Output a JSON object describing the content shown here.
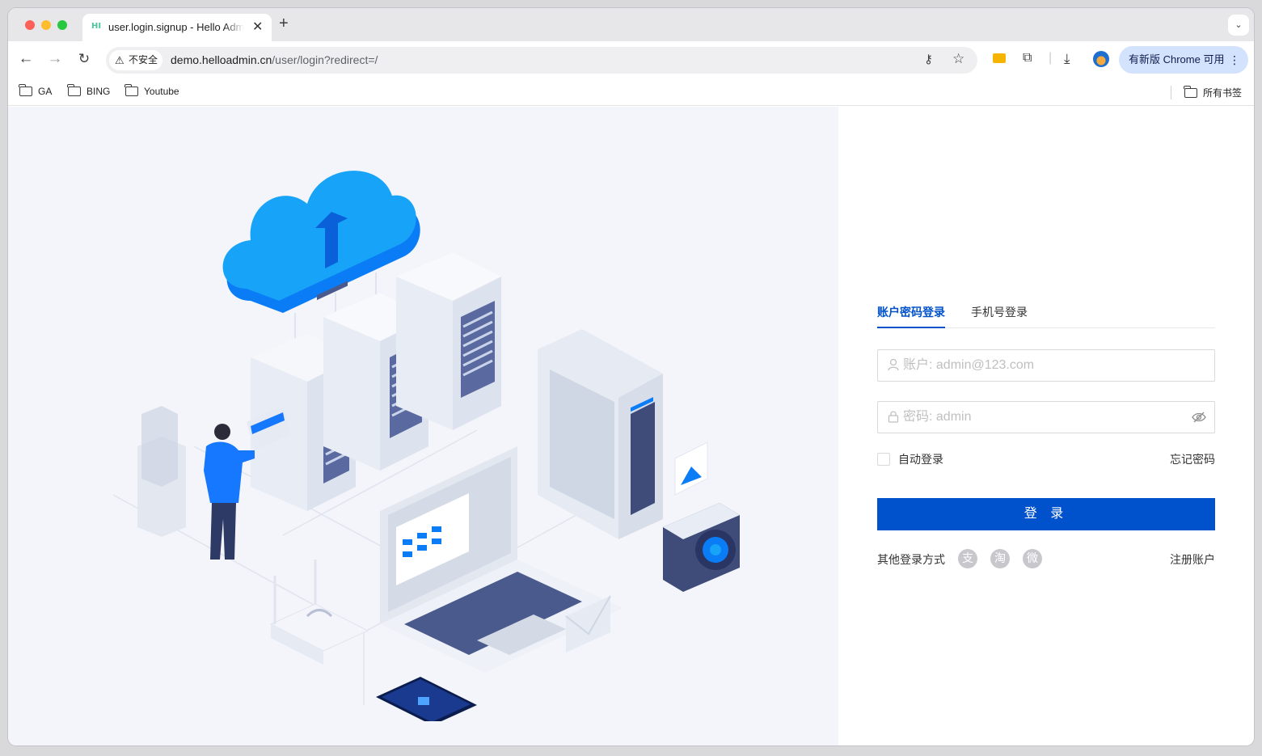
{
  "browser": {
    "tab_title": "user.login.signup - Hello Admin",
    "tab_favicon": "HI",
    "new_tab": "+",
    "security_label": "不安全",
    "url_host": "demo.helloadmin.cn",
    "url_path": "/user/login?redirect=/",
    "update_label": "有新版 Chrome 可用",
    "bookmarks": [
      "GA",
      "BING",
      "Youtube"
    ],
    "all_bookmarks": "所有书签"
  },
  "login": {
    "tabs": [
      "账户密码登录",
      "手机号登录"
    ],
    "active_tab": 0,
    "account_placeholder": "账户: admin@123.com",
    "password_placeholder": "密码: admin",
    "remember_label": "自动登录",
    "forgot_label": "忘记密码",
    "submit_label": "登 录",
    "other_methods_label": "其他登录方式",
    "social": [
      "支",
      "淘",
      "微"
    ],
    "register_label": "注册账户"
  },
  "colors": {
    "primary": "#0052cc",
    "illustration_blue": "#1677ff",
    "left_bg": "#f3f5fa"
  },
  "icons": {
    "account": "user-icon",
    "password": "lock-icon",
    "toggle_password": "eye-off-icon",
    "social": [
      "alipay-icon",
      "taobao-icon",
      "weibo-icon"
    ]
  }
}
